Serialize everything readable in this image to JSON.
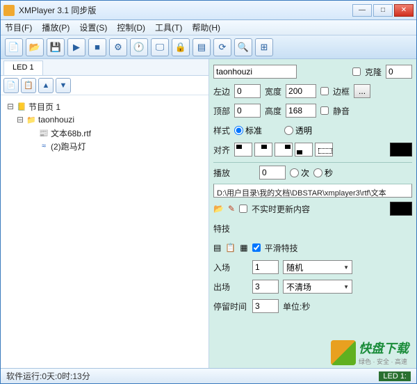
{
  "window": {
    "title": "XMPlayer 3.1 同步版"
  },
  "menu": {
    "program": "节目(F)",
    "play": "播放(P)",
    "settings": "设置(S)",
    "control": "控制(D)",
    "tools": "工具(T)",
    "help": "帮助(H)"
  },
  "tab": {
    "led1": "LED 1"
  },
  "tree": {
    "root": "节目页  1",
    "node1": "taonhouzi",
    "leaf1": "文本68b.rtf",
    "leaf2": "(2)跑马灯"
  },
  "props": {
    "name_value": "taonhouzi",
    "clone": "克隆",
    "clone_val": "0",
    "left": "左边",
    "left_val": "0",
    "width": "宽度",
    "width_val": "200",
    "border": "边框",
    "top": "顶部",
    "top_val": "0",
    "height": "高度",
    "height_val": "168",
    "mute": "静音",
    "style": "样式",
    "style_std": "标准",
    "style_trans": "透明",
    "align": "对齐",
    "play": "播放",
    "play_val": "0",
    "times": "次",
    "secs": "秒",
    "path": "D:\\用户目录\\我的文档\\DBSTAR\\xmplayer3\\rtf\\文本",
    "realtime": "不实时更新内容",
    "effects": "特技",
    "smooth": "平滑特技",
    "enter": "入场",
    "enter_val": "1",
    "enter_sel": "随机",
    "exit": "出场",
    "exit_val": "3",
    "exit_sel": "不清场",
    "stay": "停留时间",
    "stay_val": "3",
    "unit": "单位:秒"
  },
  "status": {
    "runtime": "软件运行:0天:0时:13分",
    "led": "LED 1:"
  },
  "watermark": {
    "brand": "快盘下载",
    "slogan": "绿色 · 安全 · 高速"
  }
}
